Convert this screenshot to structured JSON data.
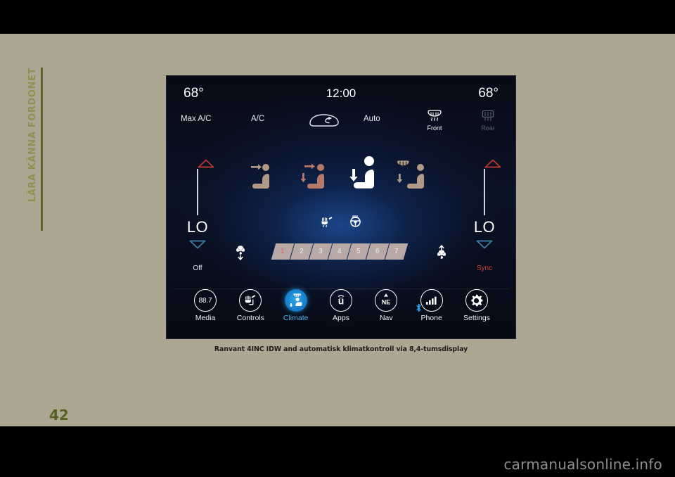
{
  "page": {
    "side_tab_text": "LÄRA KÄNNA FORDONET",
    "page_number": "42",
    "watermark": "carmanualsonline.info",
    "caption": "Ranvant 4INC IDW and automatisk klimatkontroll via 8,4-tumsdisplay"
  },
  "colors": {
    "sheet": "#ada693",
    "side_rule": "#5d6429",
    "side_text": "#8d9152",
    "page_number": "#55601f",
    "accent_blue": "#4db8ef",
    "warm_red": "#d0403c",
    "cool_blue": "#3f7fa8",
    "slider_track": "#b9a9a6",
    "slider_active_text": "#e0605a"
  },
  "screen": {
    "clock": "12:00",
    "temp_left": "68°",
    "temp_right": "68°",
    "controls_row": [
      {
        "label": "Max A/C",
        "name": "max-ac-button",
        "state": "on"
      },
      {
        "label": "A/C",
        "name": "ac-button",
        "state": "on"
      },
      {
        "label": "",
        "name": "recirculation-icon",
        "state": "on"
      },
      {
        "label": "Auto",
        "name": "auto-button",
        "state": "on"
      },
      {
        "label": "Front",
        "name": "front-defrost-button",
        "state": "on"
      },
      {
        "label": "Rear",
        "name": "rear-defrost-button",
        "state": "off"
      }
    ],
    "left_zone": {
      "value": "LO",
      "footer": "Off",
      "up_name": "temp-up-left",
      "down_name": "temp-down-left"
    },
    "right_zone": {
      "value": "LO",
      "footer": "Sync",
      "up_name": "temp-up-right",
      "down_name": "temp-down-right"
    },
    "airflow_modes": [
      {
        "name": "airflow-face",
        "active": false
      },
      {
        "name": "airflow-face-floor",
        "active": false
      },
      {
        "name": "airflow-floor",
        "active": true
      },
      {
        "name": "airflow-floor-defrost",
        "active": false
      }
    ],
    "heated_controls": [
      {
        "name": "heated-seat-icon"
      },
      {
        "name": "heated-steering-wheel-icon"
      }
    ],
    "fan": {
      "segments": [
        "1",
        "2",
        "3",
        "4",
        "5",
        "6",
        "7"
      ],
      "active_index": 0,
      "decrease_name": "fan-decrease",
      "increase_name": "fan-increase"
    },
    "nav": [
      {
        "label": "Media",
        "icon": "radio-frequency-icon",
        "value": "88.7",
        "active": false
      },
      {
        "label": "Controls",
        "icon": "controls-icon",
        "value": "",
        "active": false
      },
      {
        "label": "Climate",
        "icon": "climate-icon",
        "value": "",
        "active": true
      },
      {
        "label": "Apps",
        "icon": "uconnect-apps-icon",
        "value": "ü",
        "active": false
      },
      {
        "label": "Nav",
        "icon": "compass-nav-icon",
        "value": "NE",
        "active": false
      },
      {
        "label": "Phone",
        "icon": "signal-bars-icon",
        "value": "",
        "active": false
      },
      {
        "label": "Settings",
        "icon": "gear-icon",
        "value": "",
        "active": false
      }
    ]
  }
}
